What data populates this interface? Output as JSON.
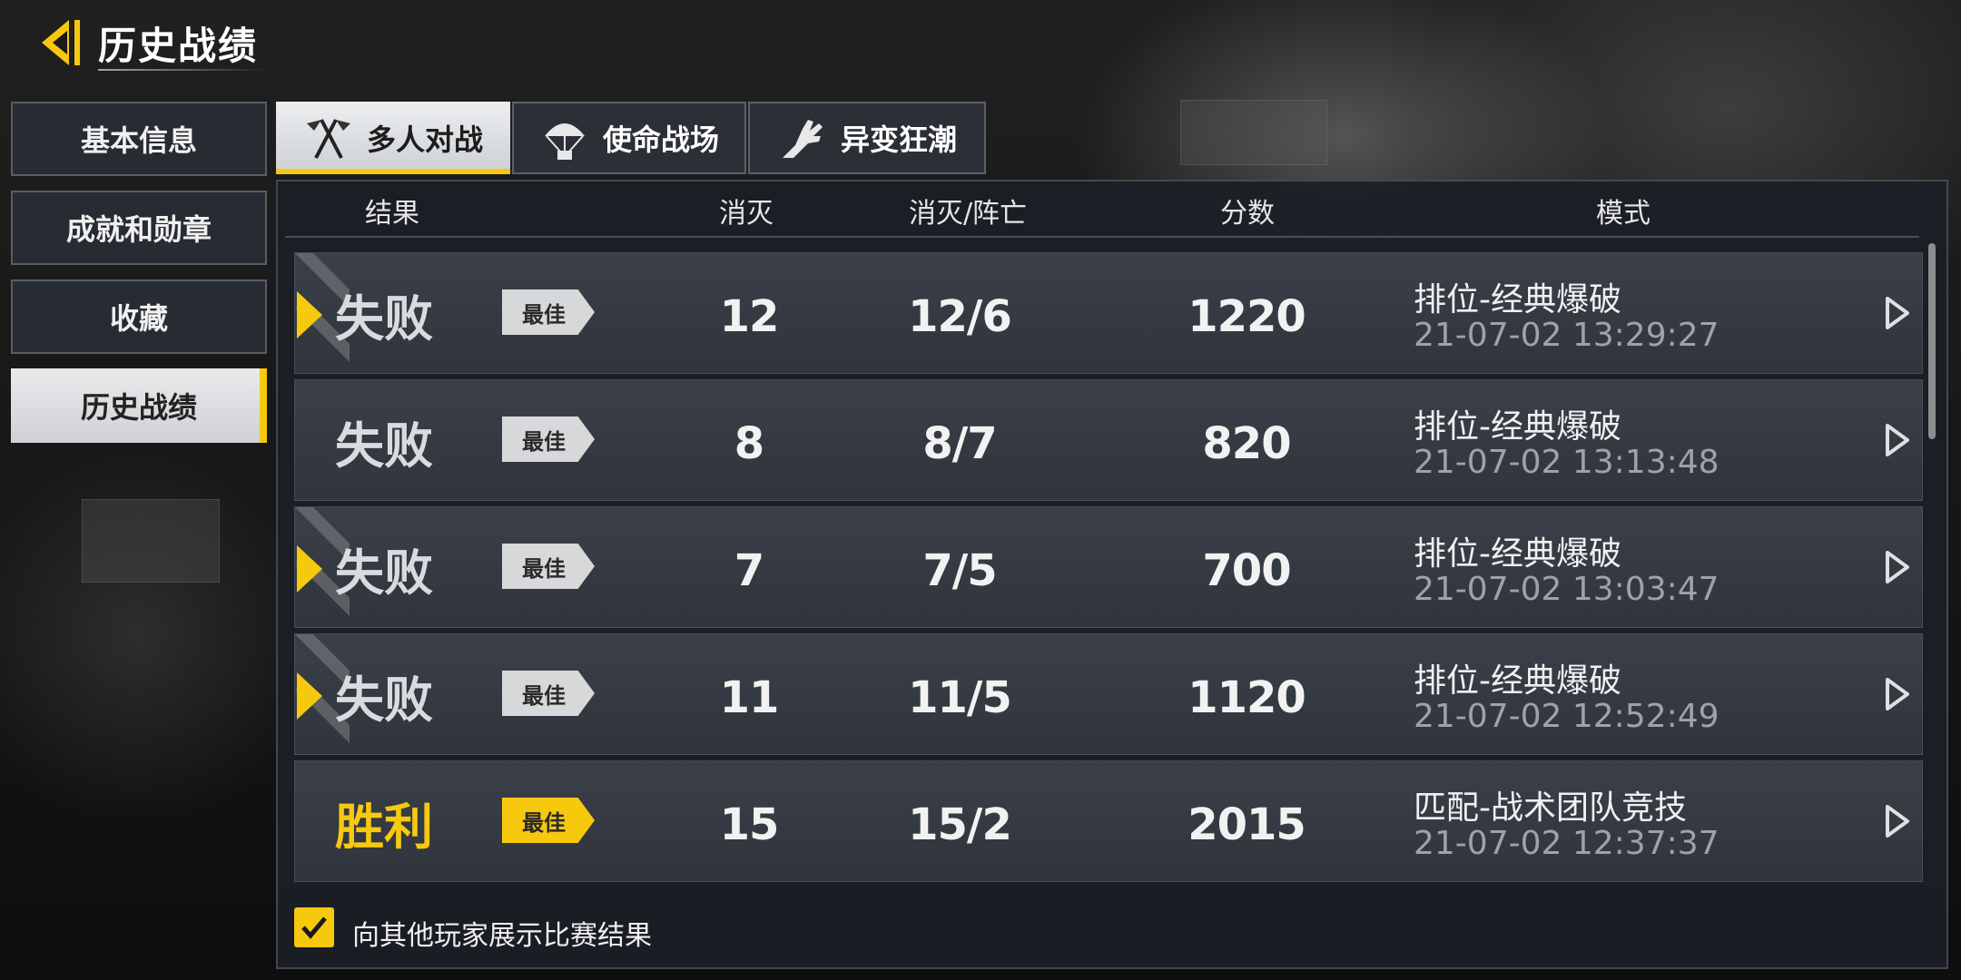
{
  "header": {
    "title": "历史战绩"
  },
  "sidebar": {
    "items": [
      {
        "label": "基本信息",
        "active": false
      },
      {
        "label": "成就和勋章",
        "active": false
      },
      {
        "label": "收藏",
        "active": false
      },
      {
        "label": "历史战绩",
        "active": true
      }
    ]
  },
  "tabs": [
    {
      "label": "多人对战",
      "icon": "flags-icon",
      "active": true
    },
    {
      "label": "使命战场",
      "icon": "parachute-icon",
      "active": false
    },
    {
      "label": "异变狂潮",
      "icon": "mutant-hand-icon",
      "active": false
    }
  ],
  "table": {
    "columns": [
      "结果",
      "消灭",
      "消灭/阵亡",
      "分数",
      "模式"
    ],
    "rows": [
      {
        "result": "失败",
        "badge": "最佳",
        "kills": "12",
        "kd": "12/6",
        "score": "1220",
        "mode": "排位-经典爆破",
        "time": "21-07-02 13:29:27",
        "marker": true,
        "win": false
      },
      {
        "result": "失败",
        "badge": "最佳",
        "kills": "8",
        "kd": "8/7",
        "score": "820",
        "mode": "排位-经典爆破",
        "time": "21-07-02 13:13:48",
        "marker": false,
        "win": false
      },
      {
        "result": "失败",
        "badge": "最佳",
        "kills": "7",
        "kd": "7/5",
        "score": "700",
        "mode": "排位-经典爆破",
        "time": "21-07-02 13:03:47",
        "marker": true,
        "win": false
      },
      {
        "result": "失败",
        "badge": "最佳",
        "kills": "11",
        "kd": "11/5",
        "score": "1120",
        "mode": "排位-经典爆破",
        "time": "21-07-02 12:52:49",
        "marker": true,
        "win": false
      },
      {
        "result": "胜利",
        "badge": "最佳",
        "kills": "15",
        "kd": "15/2",
        "score": "2015",
        "mode": "匹配-战术团队竞技",
        "time": "21-07-02 12:37:37",
        "marker": false,
        "win": true
      }
    ]
  },
  "footer": {
    "checkbox_label": "向其他玩家展示比赛结果",
    "checked": true
  },
  "colors": {
    "accent": "#f6c90e",
    "panel": "#1c1f26",
    "row": "#353a42"
  }
}
